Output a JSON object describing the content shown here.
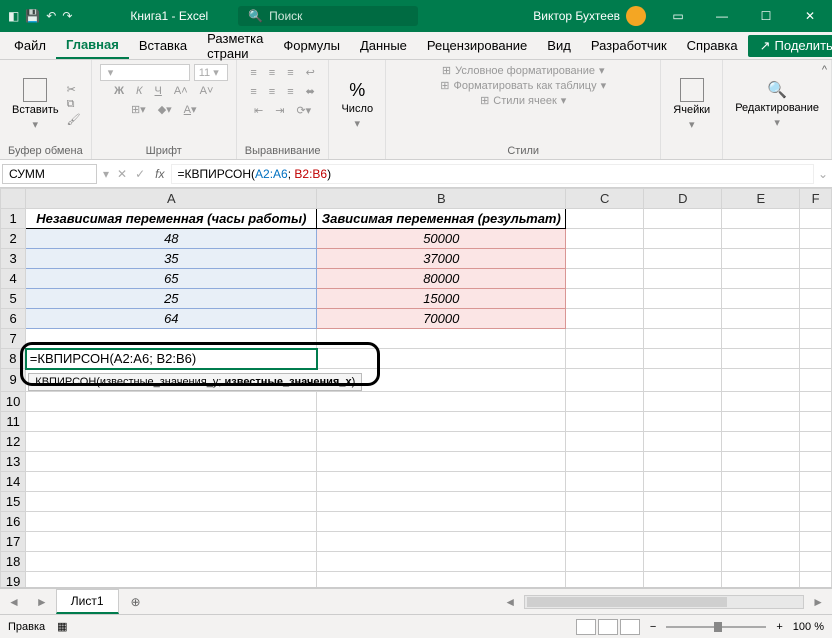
{
  "title": "Книга1 - Excel",
  "search_placeholder": "Поиск",
  "user": "Виктор Бухтеев",
  "tabs": {
    "file": "Файл",
    "home": "Главная",
    "insert": "Вставка",
    "layout": "Разметка страни",
    "formulas": "Формулы",
    "data": "Данные",
    "review": "Рецензирование",
    "view": "Вид",
    "developer": "Разработчик",
    "help": "Справка",
    "share": "Поделиться"
  },
  "ribbon": {
    "clipboard": "Буфер обмена",
    "paste": "Вставить",
    "font": "Шрифт",
    "align": "Выравнивание",
    "number": "Число",
    "styles": "Стили",
    "cond_fmt": "Условное форматирование",
    "fmt_table": "Форматировать как таблицу",
    "cell_styles": "Стили ячеек",
    "cells": "Ячейки",
    "editing": "Редактирование"
  },
  "namebox": "СУММ",
  "formula_text": "=КВПИРСОН(A2:A6; B2:B6)",
  "formula_parts": {
    "fn": "=КВПИРСОН(",
    "r1": "A2:A6",
    "sep": "; ",
    "r2": "B2:B6",
    "end": ")"
  },
  "tooltip": "КВПИРСОН(известные_значения_y; известные_значения_x)",
  "cols": [
    "A",
    "B",
    "C",
    "D",
    "E",
    "F"
  ],
  "headers": {
    "A": "Независимая переменная (часы работы)",
    "B": "Зависимая переменная (результат)"
  },
  "data": {
    "A": [
      "48",
      "35",
      "65",
      "25",
      "64"
    ],
    "B": [
      "50000",
      "37000",
      "80000",
      "15000",
      "70000"
    ]
  },
  "sheet": "Лист1",
  "status_text": "Правка",
  "zoom": "100 %",
  "chart_data": {
    "type": "table",
    "columns": [
      "Независимая переменная (часы работы)",
      "Зависимая переменная (результат)"
    ],
    "rows": [
      [
        48,
        50000
      ],
      [
        35,
        37000
      ],
      [
        65,
        80000
      ],
      [
        25,
        15000
      ],
      [
        64,
        70000
      ]
    ]
  }
}
